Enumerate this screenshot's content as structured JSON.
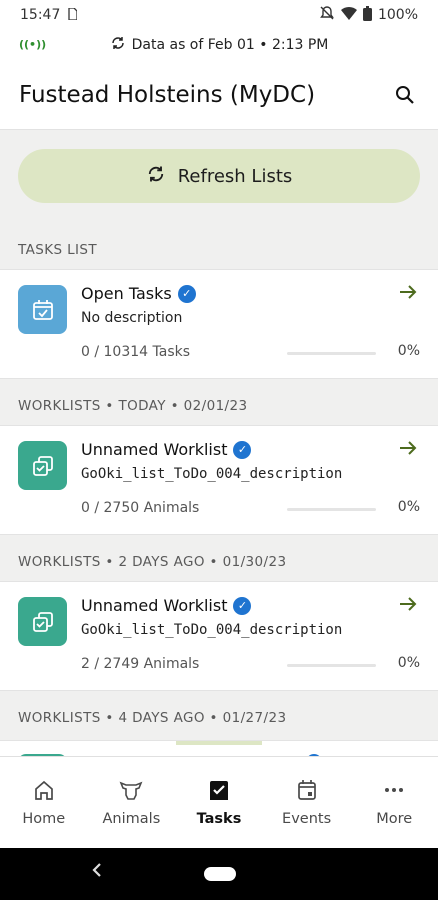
{
  "status_bar": {
    "time": "15:47",
    "sim_icon": "sim-card-icon",
    "battery": "100%"
  },
  "sync_bar": {
    "text": "Data as of Feb 01 • 2:13 PM",
    "live_icon": "((•))"
  },
  "app_bar": {
    "title": "Fustead Holsteins (MyDC)"
  },
  "refresh_button": {
    "label": "Refresh Lists"
  },
  "sections": [
    {
      "header": "TASKS LIST",
      "card": {
        "title": "Open Tasks",
        "description": "No description",
        "count": "0 / 10314 Tasks",
        "percent": "0%",
        "progress": 0,
        "icon": "calendar-check-icon"
      }
    },
    {
      "header": "WORKLISTS • TODAY • 02/01/23",
      "card": {
        "title": "Unnamed Worklist",
        "description": "GoOki_list_ToDo_004_description",
        "count": "0 / 2750 Animals",
        "percent": "0%",
        "progress": 0,
        "icon": "worklist-icon"
      }
    },
    {
      "header": "WORKLISTS • 2  DAYS AGO • 01/30/23",
      "card": {
        "title": "Unnamed Worklist",
        "description": "GoOki_list_ToDo_004_description",
        "count": "2 / 2749 Animals",
        "percent": "0%",
        "progress": 0.0007,
        "icon": "worklist-icon"
      }
    },
    {
      "header": "WORKLISTS • 4  DAYS AGO • 01/27/23"
    }
  ],
  "bottom_nav": [
    {
      "label": "Home",
      "icon": "home-icon",
      "active": false
    },
    {
      "label": "Animals",
      "icon": "cow-icon",
      "active": false
    },
    {
      "label": "Tasks",
      "icon": "tasks-icon",
      "active": true
    },
    {
      "label": "Events",
      "icon": "calendar-icon",
      "active": false
    },
    {
      "label": "More",
      "icon": "more-icon",
      "active": false
    }
  ],
  "colors": {
    "accent": "#4d6b1e",
    "refresh_bg": "#dde6c4",
    "task_tile": "#5aa7d6",
    "worklist_tile": "#3aa88e",
    "verified": "#1f74d0"
  }
}
